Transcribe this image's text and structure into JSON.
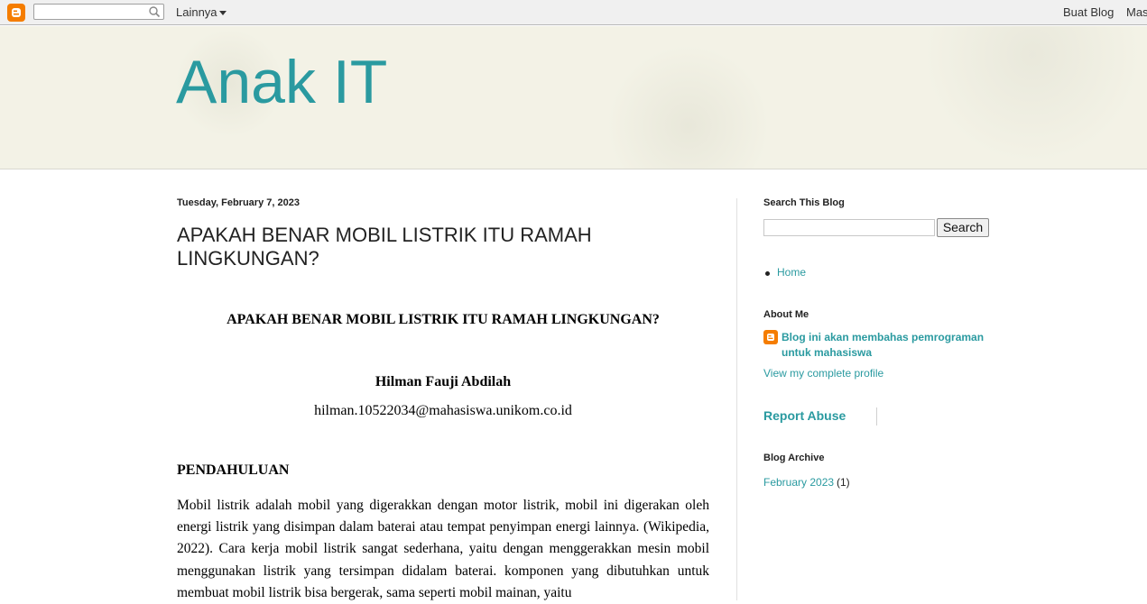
{
  "navbar": {
    "search_placeholder": "",
    "more_label": "Lainnya",
    "create_blog_label": "Buat Blog",
    "sign_in_label": "Mas"
  },
  "header": {
    "title": "Anak IT"
  },
  "post": {
    "date": "Tuesday, February 7, 2023",
    "title": "APAKAH BENAR MOBIL LISTRIK ITU RAMAH LINGKUNGAN?",
    "body": {
      "heading": "APAKAH BENAR MOBIL LISTRIK ITU RAMAH LINGKUNGAN?",
      "author": "Hilman Fauji Abdilah",
      "email": "hilman.10522034@mahasiswa.unikom.co.id",
      "section": "PENDAHULUAN",
      "paragraph": "Mobil listrik adalah mobil yang digerakkan dengan motor listrik, mobil ini digerakan oleh energi listrik yang disimpan dalam baterai atau tempat penyimpan energi lainnya. (Wikipedia, 2022). Cara kerja mobil listrik sangat sederhana, yaitu dengan menggerakkan mesin mobil menggunakan listrik yang tersimpan didalam baterai. komponen yang dibutuhkan untuk membuat mobil listrik bisa bergerak, sama seperti mobil mainan, yaitu"
    }
  },
  "sidebar": {
    "search_heading": "Search This Blog",
    "search_button": "Search",
    "pages": [
      {
        "label": "Home"
      }
    ],
    "about_heading": "About Me",
    "about_text": "Blog ini akan membahas pemrograman untuk mahasiswa",
    "profile_link": "View my complete profile",
    "report_abuse": "Report Abuse",
    "archive_heading": "Blog Archive",
    "archive_items": [
      {
        "label": "February 2023",
        "count": "(1)"
      }
    ]
  },
  "colors": {
    "accent": "#2a9aa0",
    "blogger_orange": "#f57d00",
    "header_bg": "#f3f2e6"
  }
}
